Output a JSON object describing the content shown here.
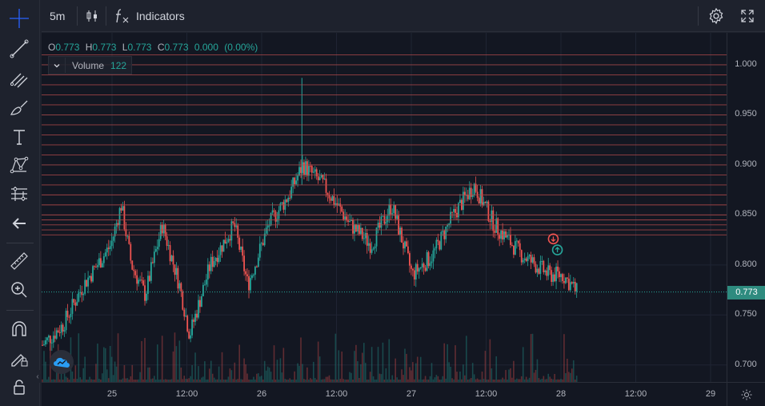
{
  "toolbar": {
    "interval": "5m",
    "indicators_label": "Indicators",
    "chart_type_icon": "candles-icon",
    "fx_icon": "fx-icon",
    "settings_icon": "gear-icon",
    "fullscreen_icon": "fullscreen-icon"
  },
  "sidebar": {
    "tools": [
      {
        "name": "crosshair-icon"
      },
      {
        "name": "trend-line-icon"
      },
      {
        "name": "fib-retracement-icon"
      },
      {
        "name": "brush-icon"
      },
      {
        "name": "text-icon"
      },
      {
        "name": "pattern-icon"
      },
      {
        "name": "prediction-icon"
      },
      {
        "name": "arrow-left-icon"
      },
      {
        "name": "ruler-icon"
      },
      {
        "name": "zoom-in-icon"
      },
      {
        "name": "magnet-icon"
      },
      {
        "name": "lock-drawing-icon"
      },
      {
        "name": "lock-icon"
      }
    ]
  },
  "legend": {
    "o_key": "O",
    "o": "0.773",
    "h_key": "H",
    "h": "0.773",
    "l_key": "L",
    "l": "0.773",
    "c_key": "C",
    "c": "0.773",
    "change": "0.000",
    "change_pct": "(0.00%)"
  },
  "volume_legend": {
    "label": "Volume",
    "value": "122"
  },
  "current_price": "0.773",
  "colors": {
    "up": "#26a69a",
    "down": "#ef5350",
    "level_line": "#b24a4a",
    "bg": "#131722",
    "panel": "#1e222d"
  },
  "chart_data": {
    "type": "candlestick",
    "y_ticks": [
      "1.000",
      "0.950",
      "0.900",
      "0.850",
      "0.800",
      "0.750",
      "0.700"
    ],
    "x_ticks": [
      "25",
      "12:00",
      "26",
      "12:00",
      "27",
      "12:00",
      "28",
      "12:00",
      "29"
    ],
    "ylim": [
      0.683,
      1.032
    ],
    "horizontal_levels": [
      1.01,
      1.0,
      0.99,
      0.98,
      0.97,
      0.96,
      0.95,
      0.94,
      0.93,
      0.92,
      0.91,
      0.9,
      0.89,
      0.88,
      0.87,
      0.86,
      0.85,
      0.845,
      0.84,
      0.835,
      0.83
    ],
    "current_price": 0.773,
    "path_anchors": [
      [
        0,
        0.72
      ],
      [
        0.03,
        0.74
      ],
      [
        0.06,
        0.78
      ],
      [
        0.1,
        0.82
      ],
      [
        0.115,
        0.86
      ],
      [
        0.13,
        0.8
      ],
      [
        0.15,
        0.77
      ],
      [
        0.175,
        0.84
      ],
      [
        0.2,
        0.78
      ],
      [
        0.215,
        0.73
      ],
      [
        0.245,
        0.8
      ],
      [
        0.28,
        0.84
      ],
      [
        0.3,
        0.78
      ],
      [
        0.33,
        0.84
      ],
      [
        0.36,
        0.87
      ],
      [
        0.38,
        0.9
      ],
      [
        0.41,
        0.88
      ],
      [
        0.45,
        0.84
      ],
      [
        0.48,
        0.82
      ],
      [
        0.51,
        0.86
      ],
      [
        0.54,
        0.79
      ],
      [
        0.57,
        0.81
      ],
      [
        0.6,
        0.85
      ],
      [
        0.63,
        0.88
      ],
      [
        0.66,
        0.84
      ],
      [
        0.7,
        0.81
      ],
      [
        0.74,
        0.79
      ],
      [
        0.76,
        0.79
      ],
      [
        0.78,
        0.773
      ]
    ],
    "markers": [
      {
        "type": "sell",
        "price": 0.826,
        "x_frac": 0.747
      },
      {
        "type": "buy",
        "price": 0.815,
        "x_frac": 0.753
      }
    ]
  }
}
